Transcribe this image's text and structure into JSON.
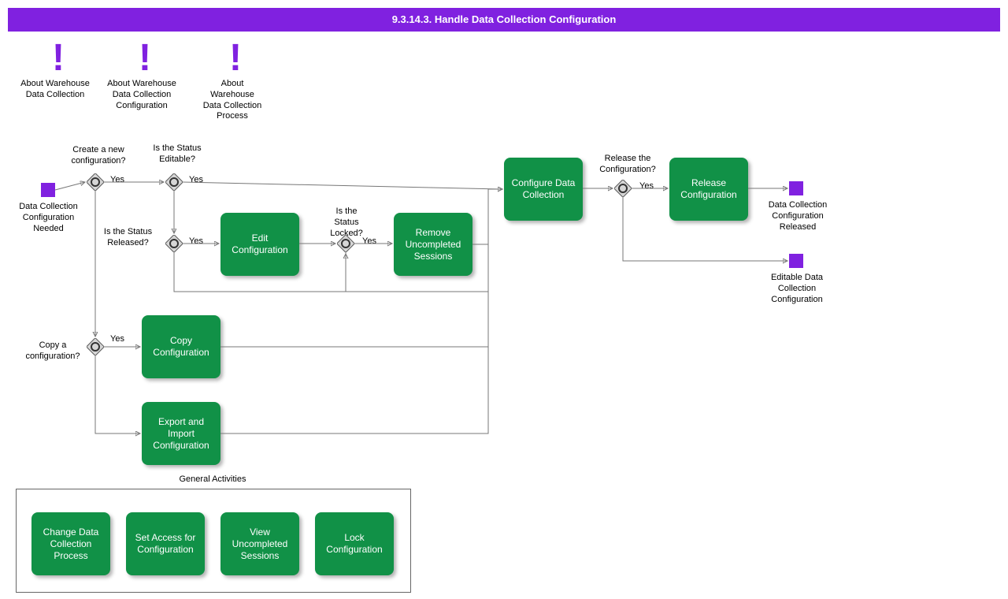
{
  "title": "9.3.14.3. Handle Data Collection Configuration",
  "notes": {
    "n1": "About Warehouse Data Collection",
    "n2": "About Warehouse Data Collection Configuration",
    "n3": "About Warehouse Data Collection Process"
  },
  "events": {
    "start": "Data Collection Configuration Needed",
    "end1": "Data Collection Configuration Released",
    "end2": "Editable Data Collection Configuration"
  },
  "gateways": {
    "g1_q": "Create a new configuration?",
    "g1_yes": "Yes",
    "g2_q": "Is the Status Editable?",
    "g2_yes": "Yes",
    "g3_q": "Is the Status Released?",
    "g3_yes": "Yes",
    "g4_q": "Is the Status Locked?",
    "g4_yes": "Yes",
    "g5_q": "Release the Configuration?",
    "g5_yes": "Yes",
    "g6_q": "Copy a configuration?",
    "g6_yes": "Yes"
  },
  "tasks": {
    "edit": "Edit Configuration",
    "remove": "Remove Uncompleted Sessions",
    "configure": "Configure Data Collection",
    "release": "Release Configuration",
    "copy": "Copy Configuration",
    "export": "Export and Import Configuration"
  },
  "general_activities": {
    "title": "General Activities",
    "a1": "Change Data Collection Process",
    "a2": "Set Access for Configuration",
    "a3": "View Uncompleted Sessions",
    "a4": "Lock Configuration"
  }
}
